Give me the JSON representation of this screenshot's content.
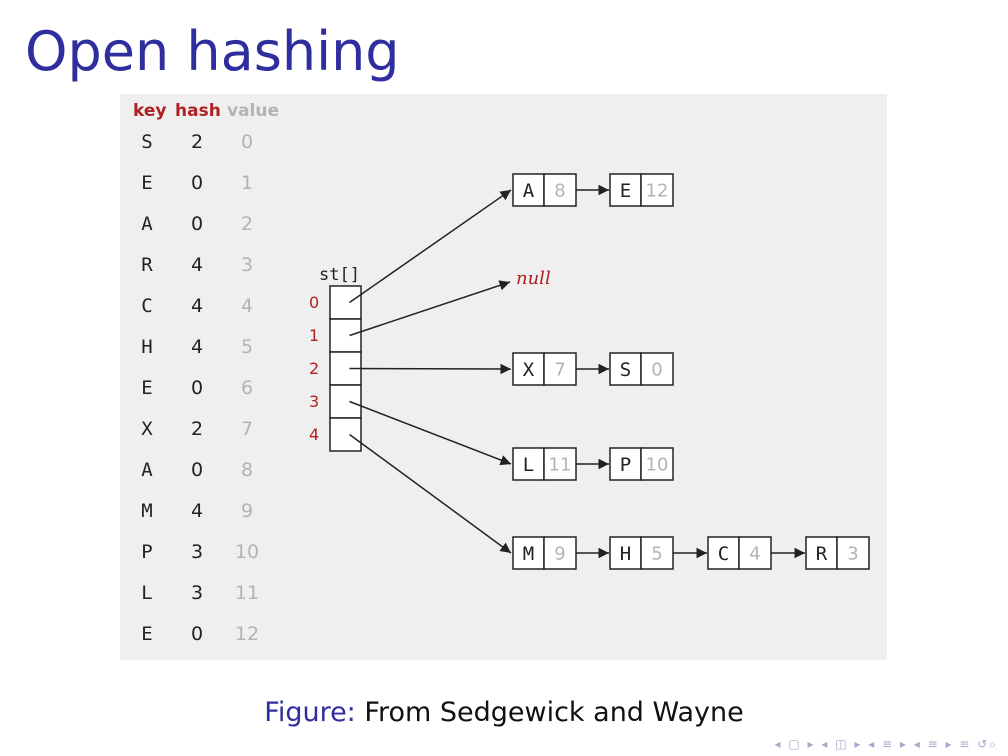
{
  "title": "Open hashing",
  "table": {
    "headers": {
      "key": "key",
      "hash": "hash",
      "value": "value"
    },
    "rows": [
      {
        "key": "S",
        "hash": "2",
        "value": "0"
      },
      {
        "key": "E",
        "hash": "0",
        "value": "1"
      },
      {
        "key": "A",
        "hash": "0",
        "value": "2"
      },
      {
        "key": "R",
        "hash": "4",
        "value": "3"
      },
      {
        "key": "C",
        "hash": "4",
        "value": "4"
      },
      {
        "key": "H",
        "hash": "4",
        "value": "5"
      },
      {
        "key": "E",
        "hash": "0",
        "value": "6"
      },
      {
        "key": "X",
        "hash": "2",
        "value": "7"
      },
      {
        "key": "A",
        "hash": "0",
        "value": "8"
      },
      {
        "key": "M",
        "hash": "4",
        "value": "9"
      },
      {
        "key": "P",
        "hash": "3",
        "value": "10"
      },
      {
        "key": "L",
        "hash": "3",
        "value": "11"
      },
      {
        "key": "E",
        "hash": "0",
        "value": "12"
      }
    ]
  },
  "array": {
    "label": "st[]",
    "indices": [
      "0",
      "1",
      "2",
      "3",
      "4"
    ],
    "null_label": "null"
  },
  "chains": [
    [
      {
        "key": "A",
        "value": "8"
      },
      {
        "key": "E",
        "value": "12"
      }
    ],
    [],
    [
      {
        "key": "X",
        "value": "7"
      },
      {
        "key": "S",
        "value": "0"
      }
    ],
    [
      {
        "key": "L",
        "value": "11"
      },
      {
        "key": "P",
        "value": "10"
      }
    ],
    [
      {
        "key": "M",
        "value": "9"
      },
      {
        "key": "H",
        "value": "5"
      },
      {
        "key": "C",
        "value": "4"
      },
      {
        "key": "R",
        "value": "3"
      }
    ]
  ],
  "caption": {
    "label": "Figure:",
    "text": "From Sedgewick and Wayne"
  },
  "colors": {
    "title": "#2e2e9e",
    "accent_red": "#b02020",
    "muted_value": "#b3b3b3",
    "figure_bg": "#efefef"
  },
  "nav_icons": [
    "nav-prev-frame-icon",
    "nav-next-frame-icon",
    "nav-prev-subsection-icon",
    "nav-next-subsection-icon",
    "nav-prev-section-icon",
    "nav-next-section-icon",
    "nav-search-icon"
  ]
}
